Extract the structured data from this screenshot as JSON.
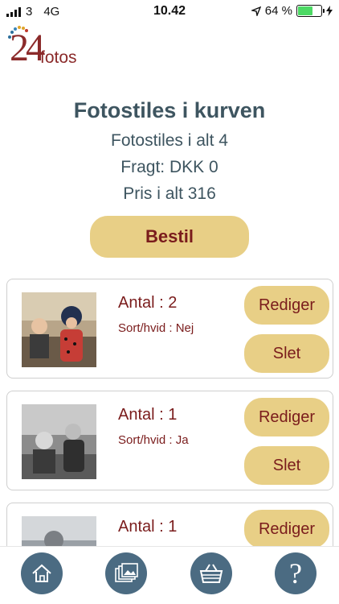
{
  "status_bar": {
    "carrier": "3",
    "network": "4G",
    "time": "10.42",
    "battery": "64 %",
    "battery_level": 0.64
  },
  "logo": {
    "number": "24",
    "word": "fotos"
  },
  "summary": {
    "title": "Fotostiles i kurven",
    "count_line": "Fotostiles i alt 4",
    "shipping_line": "Fragt: DKK 0",
    "price_line": "Pris i alt 316"
  },
  "order_button": "Bestil",
  "items": [
    {
      "qty": "Antal : 2",
      "bw": "Sort/hvid : Nej",
      "edit": "Rediger",
      "delete": "Slet"
    },
    {
      "qty": "Antal : 1",
      "bw": "Sort/hvid : Ja",
      "edit": "Rediger",
      "delete": "Slet"
    },
    {
      "qty": "Antal : 1",
      "bw": "",
      "edit": "Rediger",
      "delete": ""
    }
  ],
  "nav": {
    "icons": [
      "home-icon",
      "photos-icon",
      "basket-icon",
      "help-icon"
    ],
    "help_glyph": "?"
  },
  "colors": {
    "accent": "#e8cf86",
    "brand_text": "#7a1c1c",
    "heading": "#3e5560",
    "nav_circle": "#4b6b82"
  }
}
